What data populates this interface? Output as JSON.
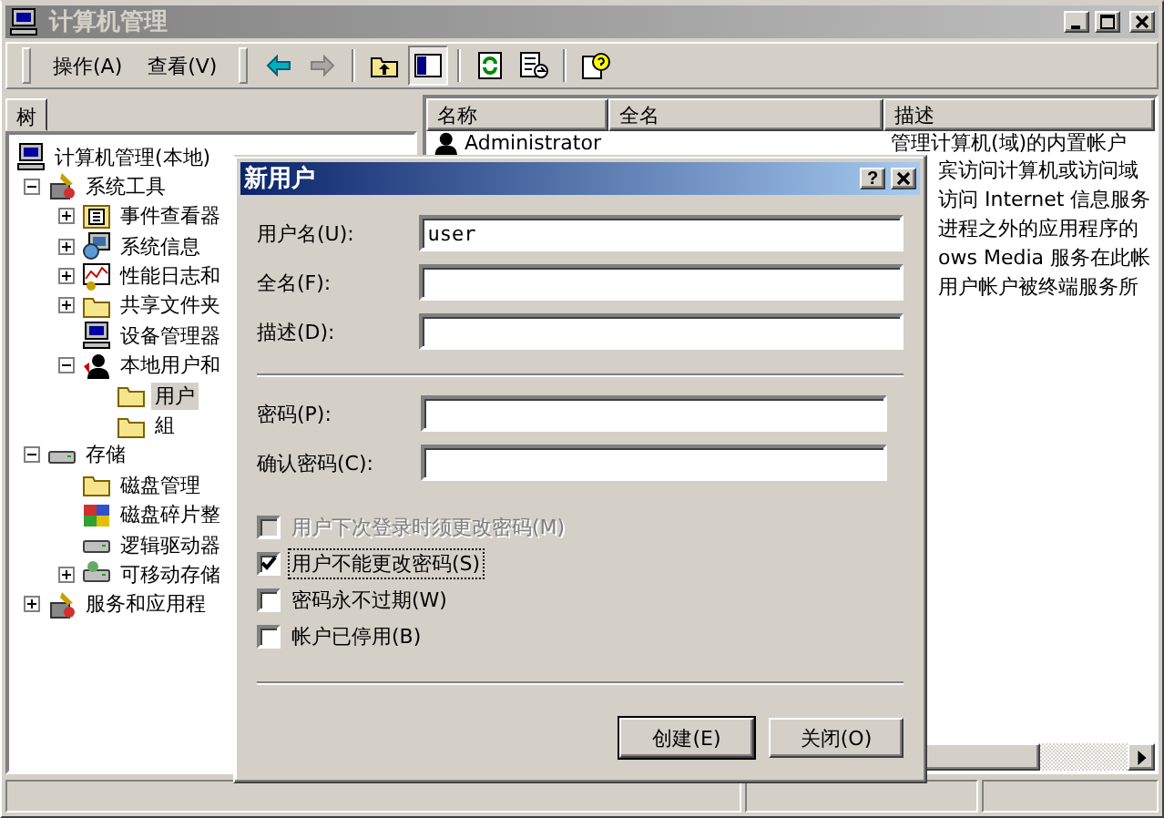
{
  "window": {
    "title": "计算机管理",
    "active": false
  },
  "toolbar": {
    "menus": [
      "操作(A)",
      "查看(V)"
    ],
    "buttons": [
      {
        "kind": "back",
        "disabled": false,
        "pressed": false
      },
      {
        "kind": "forward",
        "disabled": true,
        "pressed": false
      },
      {
        "kind": "up",
        "disabled": false,
        "pressed": false
      },
      {
        "kind": "tree",
        "disabled": false,
        "pressed": true
      },
      {
        "kind": "refresh",
        "disabled": false,
        "pressed": false
      },
      {
        "kind": "export",
        "disabled": false,
        "pressed": false
      },
      {
        "kind": "help",
        "disabled": false,
        "pressed": false
      }
    ]
  },
  "tree_tab": {
    "label": "树"
  },
  "tree": [
    {
      "label": "计算机管理(本地)",
      "kind": "computer",
      "selected": false,
      "children": [
        {
          "label": "系统工具",
          "kind": "tools",
          "selected": false,
          "expanded": true,
          "children": [
            {
              "label": "事件查看器",
              "kind": "viewer",
              "selected": false,
              "expanded": false
            },
            {
              "label": "系统信息",
              "kind": "info",
              "selected": false,
              "expanded": false
            },
            {
              "label": "性能日志和",
              "kind": "chart",
              "selected": false,
              "expanded": false
            },
            {
              "label": "共享文件夹",
              "kind": "folder",
              "selected": false,
              "expanded": false
            },
            {
              "label": "设备管理器",
              "kind": "device",
              "selected": false
            },
            {
              "label": "本地用户和",
              "kind": "users",
              "selected": false,
              "expanded": true,
              "children": [
                {
                  "label": "用户",
                  "kind": "folder",
                  "selected": true
                },
                {
                  "label": "組",
                  "kind": "folder",
                  "selected": false
                }
              ]
            }
          ]
        },
        {
          "label": "存储",
          "kind": "drive",
          "selected": false,
          "expanded": true,
          "children": [
            {
              "label": "磁盘管理",
              "kind": "folder",
              "selected": false
            },
            {
              "label": "磁盘碎片整",
              "kind": "defrag",
              "selected": false
            },
            {
              "label": "逻辑驱动器",
              "kind": "drive",
              "selected": false
            },
            {
              "label": "可移动存储",
              "kind": "removable",
              "selected": false,
              "expanded": false
            }
          ]
        },
        {
          "label": "服务和应用程",
          "kind": "services",
          "selected": false,
          "expanded": false
        }
      ]
    }
  ],
  "list": {
    "columns": [
      "名称",
      "全名",
      "描述"
    ],
    "rows": [
      {
        "name": "Administrator",
        "description": "管理计算机(域)的内置帐户"
      },
      {
        "description": "宾访问计算机或访问域"
      },
      {
        "description": "访问 Internet 信息服务"
      },
      {
        "description": "进程之外的应用程序的"
      },
      {
        "description": "ows Media 服务在此帐"
      },
      {
        "description": "用户帐户被终端服务所"
      }
    ]
  },
  "dialog": {
    "title": "新用户",
    "help_label": "?",
    "fields": [
      {
        "label": "用户名(U):",
        "value": "user",
        "kind": "wide"
      },
      {
        "label": "全名(F):",
        "kind": "wide"
      },
      {
        "label": "描述(D):",
        "kind": "wide"
      },
      {
        "label": "密码(P):",
        "kind": "password"
      },
      {
        "label": "确认密码(C):",
        "kind": "password"
      }
    ],
    "options": [
      {
        "label": "用户下次登录时须更改密码(M)",
        "checked": false,
        "disabled": true,
        "focused": false
      },
      {
        "label": "用户不能更改密码(S)",
        "checked": true,
        "disabled": false,
        "focused": true
      },
      {
        "label": "密码永不过期(W)",
        "checked": false,
        "disabled": false,
        "focused": false
      },
      {
        "label": "帐户已停用(B)",
        "checked": false,
        "disabled": false,
        "focused": false
      }
    ],
    "buttons": [
      {
        "label": "创建(E)",
        "default": true
      },
      {
        "label": "关闭(O)",
        "default": false
      }
    ]
  }
}
